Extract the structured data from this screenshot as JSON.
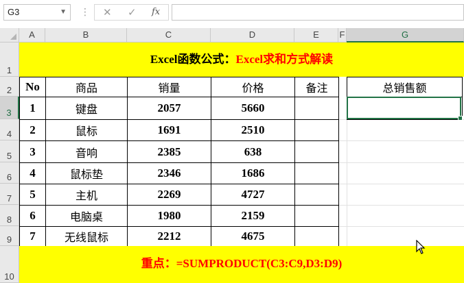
{
  "formula_bar": {
    "name_box": "G3",
    "cancel_icon": "✕",
    "enter_icon": "✓",
    "fx_label": "fx",
    "formula": ""
  },
  "columns": [
    "A",
    "B",
    "C",
    "D",
    "E",
    "F",
    "G"
  ],
  "rows": [
    "1",
    "2",
    "3",
    "4",
    "5",
    "6",
    "7",
    "8",
    "9",
    "10"
  ],
  "title": {
    "part1": "Excel函数公式：",
    "part2": "Excel求和方式解读"
  },
  "table": {
    "headers": [
      "No",
      "商品",
      "销量",
      "价格",
      "备注"
    ],
    "rows": [
      [
        "1",
        "键盘",
        "2057",
        "5660",
        ""
      ],
      [
        "2",
        "鼠标",
        "1691",
        "2510",
        ""
      ],
      [
        "3",
        "音响",
        "2385",
        "638",
        ""
      ],
      [
        "4",
        "鼠标垫",
        "2346",
        "1686",
        ""
      ],
      [
        "5",
        "主机",
        "2269",
        "4727",
        ""
      ],
      [
        "6",
        "电脑桌",
        "1980",
        "2159",
        ""
      ],
      [
        "7",
        "无线鼠标",
        "2212",
        "4675",
        ""
      ]
    ]
  },
  "total": {
    "header": "总销售额",
    "value": ""
  },
  "footer": {
    "part1": "重点：",
    "part2": "=SUMPRODUCT(C3:C9,D3:D9)"
  },
  "colors": {
    "banner_yellow": "#ffff00",
    "accent_green": "#217346",
    "red_text": "#ff0000"
  }
}
